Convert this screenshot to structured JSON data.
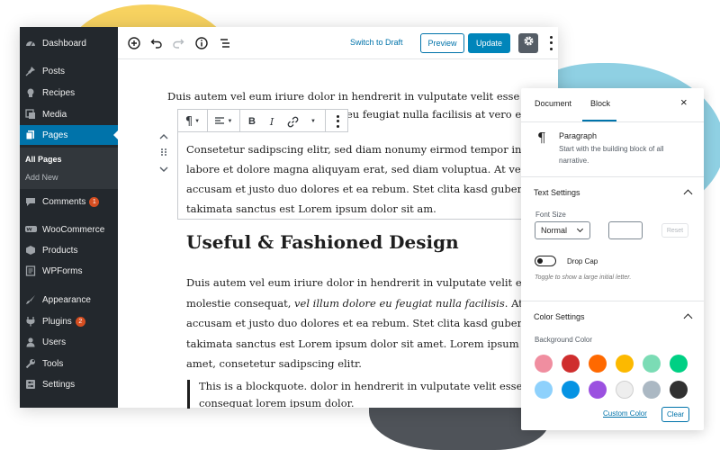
{
  "sidebar": {
    "items": [
      {
        "label": "Dashboard",
        "icon": "dashboard-icon"
      },
      {
        "label": "Posts",
        "icon": "pin-icon"
      },
      {
        "label": "Recipes",
        "icon": "recipes-icon"
      },
      {
        "label": "Media",
        "icon": "media-icon"
      },
      {
        "label": "Pages",
        "icon": "pages-icon",
        "active": true
      },
      {
        "label": "Comments",
        "icon": "comment-icon",
        "badge": "1"
      },
      {
        "label": "WooCommerce",
        "icon": "woocommerce-icon"
      },
      {
        "label": "Products",
        "icon": "products-icon"
      },
      {
        "label": "WPForms",
        "icon": "forms-icon"
      },
      {
        "label": "Appearance",
        "icon": "brush-icon"
      },
      {
        "label": "Plugins",
        "icon": "plugin-icon",
        "badge": "2"
      },
      {
        "label": "Users",
        "icon": "users-icon"
      },
      {
        "label": "Tools",
        "icon": "wrench-icon"
      },
      {
        "label": "Settings",
        "icon": "settings-icon"
      }
    ],
    "submenu": [
      {
        "label": "All Pages",
        "current": true
      },
      {
        "label": "Add New"
      }
    ]
  },
  "toolbar": {
    "switch_draft": "Switch to Draft",
    "preview": "Preview",
    "update": "Update",
    "icons": [
      "add-block-icon",
      "undo-icon",
      "redo-icon",
      "info-icon",
      "list-view-icon",
      "gear-icon",
      "more-options-icon"
    ]
  },
  "editor": {
    "para1_line1": "Duis autem vel eum iriure dolor in hendrerit in vulputate velit esse",
    "para1_line2": "re eu feugiat nulla facilisis at vero er",
    "selected_lines": [
      "Consetetur sadipscing elitr, sed diam nonumy eirmod tempor invidunt",
      "labore et dolore magna aliquyam erat, sed diam voluptua. At vero eos",
      "accusam et justo duo dolores et ea rebum. Stet clita kasd gubergren, no",
      "takimata sanctus est Lorem ipsum dolor sit am."
    ],
    "heading": "Useful & Fashioned Design",
    "para2": {
      "line1": "Duis autem vel eum iriure dolor in hendrerit in vulputate velit esse",
      "line2_start": "molestie consequat, ",
      "line2_italic": "vel illum dolore eu feugiat nulla facilisis",
      "line2_end": ". At vero eo",
      "line3": "accusam et justo duo dolores et ea rebum. Stet clita kasd gubergren, no",
      "line4": "takimata sanctus est Lorem ipsum dolor sit amet. Lorem ipsum dolor s",
      "line5": "amet, consetetur sadipscing elitr."
    },
    "quote_line1": "This is a blockquote. dolor in hendrerit in vulputate velit esse moles",
    "quote_line2": "conseguat lorem ipsum dolor."
  },
  "panel": {
    "tab_document": "Document",
    "tab_block": "Block",
    "close_symbol": "×",
    "block_title": "Paragraph",
    "block_desc_line1": "Start with the building block of all",
    "block_desc_line2": "narrative.",
    "text_settings": "Text Settings",
    "font_size_label": "Font Size",
    "font_size_value": "Normal",
    "reset": "Reset",
    "drop_cap": "Drop Cap",
    "drop_cap_help": "Toggle to show a large initial letter.",
    "color_settings": "Color Settings",
    "background_color": "Background Color",
    "custom_color": "Custom Color",
    "clear": "Clear",
    "swatches": [
      "#f08ea0",
      "#cf2e2e",
      "#ff6900",
      "#fcb900",
      "#7bdcb5",
      "#00d084",
      "#8ed1fc",
      "#0693e3",
      "#9b51e0",
      "#eeeeee",
      "#abb8c3",
      "#313131"
    ]
  }
}
